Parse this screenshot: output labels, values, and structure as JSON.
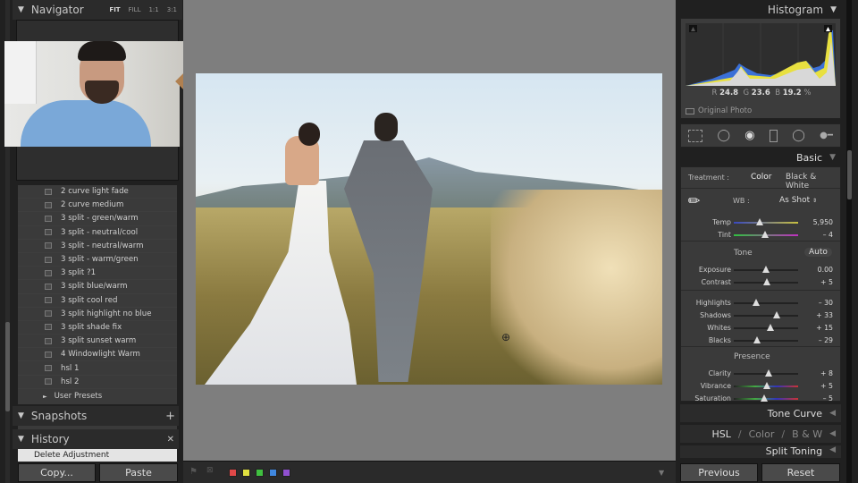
{
  "left": {
    "navigator": {
      "title": "Navigator",
      "options": [
        "FIT",
        "FILL",
        "1:1",
        "3:1"
      ]
    },
    "presets": [
      "2 curve light fade",
      "2 curve medium",
      "3 split - green/warm",
      "3 split - neutral/cool",
      "3 split - neutral/warm",
      "3 split - warm/green",
      "3 split ?1",
      "3 split blue/warm",
      "3 split cool red",
      "3 split highlight no blue",
      "3 split shade fix",
      "3 split sunset warm",
      "4 Windowlight Warm",
      "hsl 1",
      "hsl 2"
    ],
    "user_presets": "User Presets",
    "snapshots": "Snapshots",
    "history": "History",
    "history_item": "Delete Adjustment",
    "copy": "Copy...",
    "paste": "Paste"
  },
  "toolbar": {
    "color_labels": [
      "#e04848",
      "#e0e040",
      "#40c040",
      "#4088e0",
      "#9050d0"
    ]
  },
  "right": {
    "histogram": {
      "title": "Histogram",
      "r_label": "R",
      "r": "24.8",
      "g_label": "G",
      "g": "23.6",
      "b_label": "B",
      "b": "19.2",
      "pct": "%",
      "original_photo": "Original Photo"
    },
    "basic": {
      "title": "Basic",
      "treatment_label": "Treatment :",
      "color": "Color",
      "bw": "Black & White",
      "wb_label": "WB :",
      "wb": "As Shot",
      "tone": "Tone",
      "auto": "Auto",
      "presence": "Presence",
      "sliders": [
        {
          "label": "Temp",
          "value": "5,950",
          "pos": 0.4
        },
        {
          "label": "Tint",
          "value": "– 4",
          "pos": 0.48
        },
        {
          "label": "Exposure",
          "value": "0.00",
          "pos": 0.5
        },
        {
          "label": "Contrast",
          "value": "+ 5",
          "pos": 0.52
        },
        {
          "label": "Highlights",
          "value": "– 30",
          "pos": 0.35
        },
        {
          "label": "Shadows",
          "value": "+ 33",
          "pos": 0.66
        },
        {
          "label": "Whites",
          "value": "+ 15",
          "pos": 0.57
        },
        {
          "label": "Blacks",
          "value": "– 29",
          "pos": 0.36
        },
        {
          "label": "Clarity",
          "value": "+ 8",
          "pos": 0.54
        },
        {
          "label": "Vibrance",
          "value": "+ 5",
          "pos": 0.52
        },
        {
          "label": "Saturation",
          "value": "– 5",
          "pos": 0.47
        }
      ]
    },
    "tone_curve": "Tone Curve",
    "hsl": "HSL",
    "hsl_color": "Color",
    "hsl_bw": "B & W",
    "split_toning": "Split Toning",
    "previous": "Previous",
    "reset": "Reset"
  }
}
